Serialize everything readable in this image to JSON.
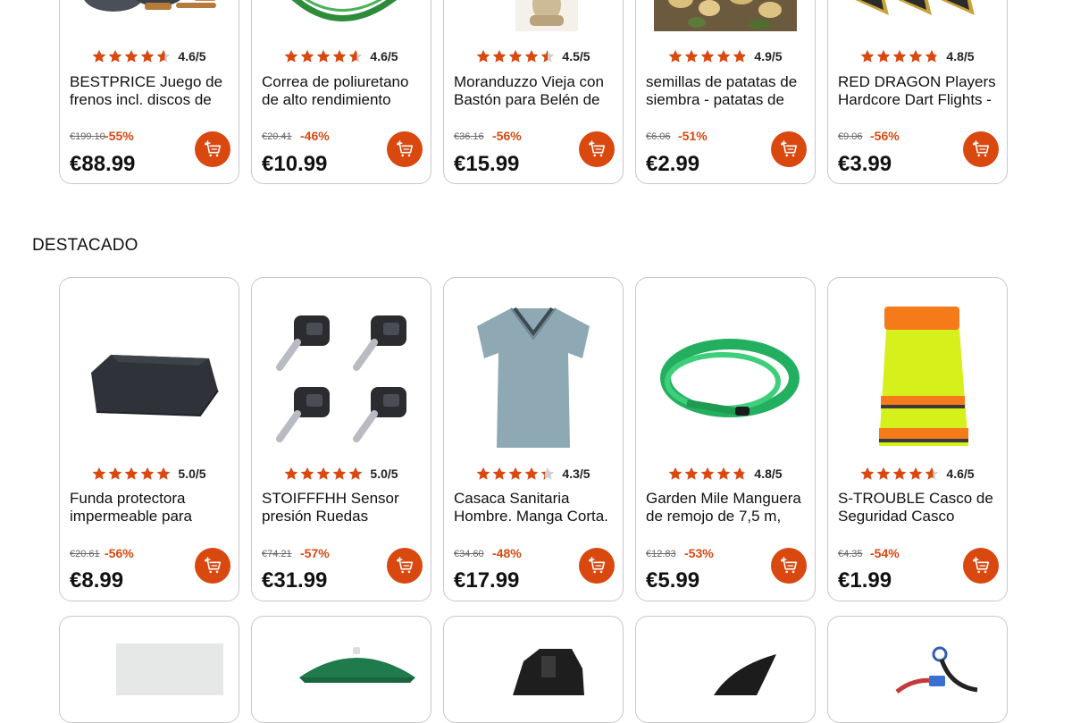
{
  "colors": {
    "accent": "#d9480f",
    "star": "#d9480f",
    "star_empty": "#d0d0d0"
  },
  "cart_icon": "add-to-cart-icon",
  "section_title": "DESTACADO",
  "top_products": [
    {
      "image": "brake-kit-image",
      "rating": 4.6,
      "rating_text": "4.6/5",
      "title": "BESTPRICE Juego de frenos incl. discos de",
      "old_price": "€199.10",
      "discount": "-55%",
      "price": "€88.99"
    },
    {
      "image": "green-belt-image",
      "rating": 4.6,
      "rating_text": "4.6/5",
      "title": "Correa de poliuretano de alto rendimiento",
      "old_price": "€20.41",
      "discount": "-46%",
      "price": "€10.99"
    },
    {
      "image": "figurine-image",
      "rating": 4.5,
      "rating_text": "4.5/5",
      "title": "Moranduzzo Vieja con Bastón para Belén de",
      "old_price": "€36.16",
      "discount": "-56%",
      "price": "€15.99"
    },
    {
      "image": "seed-potatoes-image",
      "rating": 4.9,
      "rating_text": "4.9/5",
      "title": "semillas de patatas de siembra - patatas de",
      "old_price": "€6.06",
      "discount": "-51%",
      "price": "€2.99"
    },
    {
      "image": "dart-flights-image",
      "rating": 4.8,
      "rating_text": "4.8/5",
      "title": "RED DRAGON Players Hardcore Dart Flights -",
      "old_price": "€9.06",
      "discount": "-56%",
      "price": "€3.99"
    }
  ],
  "featured_products": [
    {
      "image": "protective-cover-image",
      "rating": 5.0,
      "rating_text": "5.0/5",
      "title": "Funda protectora impermeable para",
      "old_price": "€20.61",
      "discount": "-56%",
      "price": "€8.99"
    },
    {
      "image": "tpms-sensor-image",
      "rating": 5.0,
      "rating_text": "5.0/5",
      "title": "STOIFFFHH Sensor presión Ruedas",
      "old_price": "€74.21",
      "discount": "-57%",
      "price": "€31.99"
    },
    {
      "image": "scrubs-top-image",
      "rating": 4.3,
      "rating_text": "4.3/5",
      "title": "Casaca Sanitaria Hombre. Manga Corta.",
      "old_price": "€34.60",
      "discount": "-48%",
      "price": "€17.99"
    },
    {
      "image": "soaker-hose-image",
      "rating": 4.8,
      "rating_text": "4.8/5",
      "title": "Garden Mile Manguera de remojo de 7,5 m,",
      "old_price": "€12.83",
      "discount": "-53%",
      "price": "€5.99"
    },
    {
      "image": "helmet-cover-image",
      "rating": 4.6,
      "rating_text": "4.6/5",
      "title": "S-TROUBLE Casco de Seguridad Casco",
      "old_price": "€4.35",
      "discount": "-54%",
      "price": "€1.99"
    }
  ],
  "bottom_products": [
    {
      "image": "white-box-image"
    },
    {
      "image": "green-lamp-shade-image"
    },
    {
      "image": "black-bracket-image"
    },
    {
      "image": "black-fender-image"
    },
    {
      "image": "cable-connector-image"
    }
  ]
}
